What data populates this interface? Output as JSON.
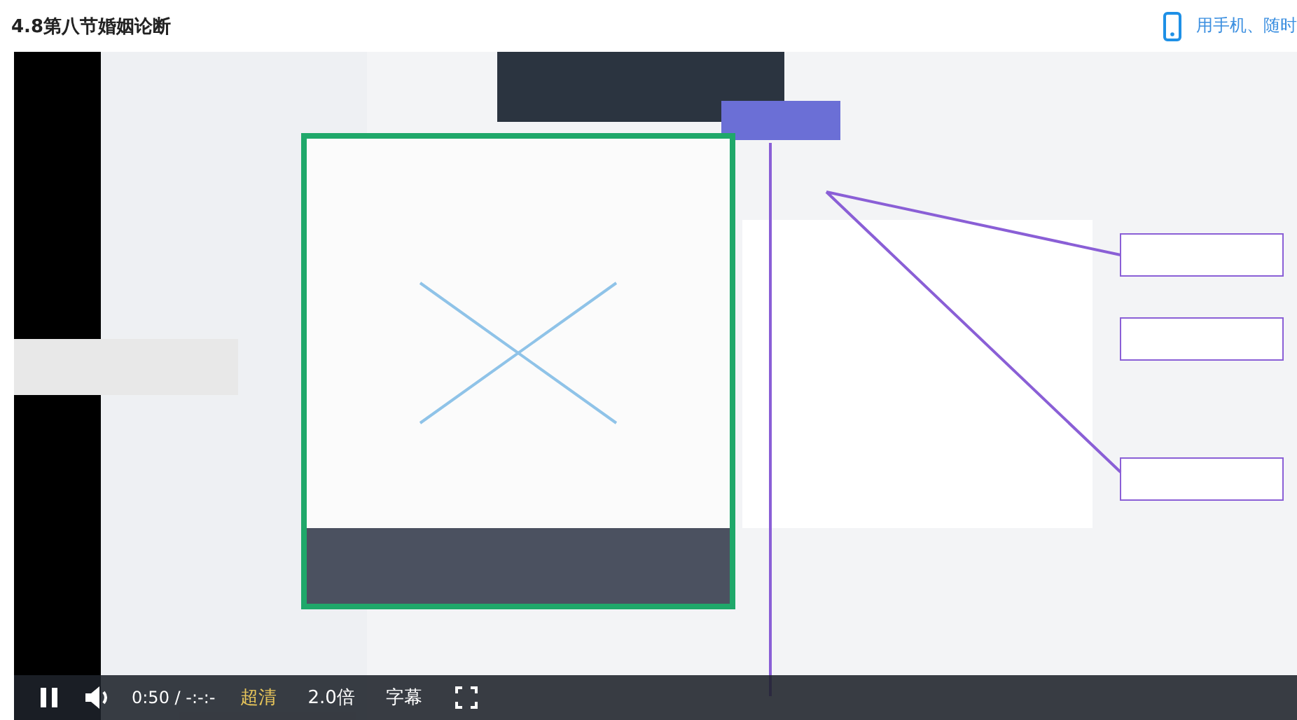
{
  "header": {
    "title": "4.8第八节婚姻论断",
    "mobile_link": "用手机、随时"
  },
  "controls": {
    "playing": true,
    "time": "0:50 / -:-:-",
    "quality": "超清",
    "speed": "2.0倍",
    "subtitles": "字幕"
  }
}
